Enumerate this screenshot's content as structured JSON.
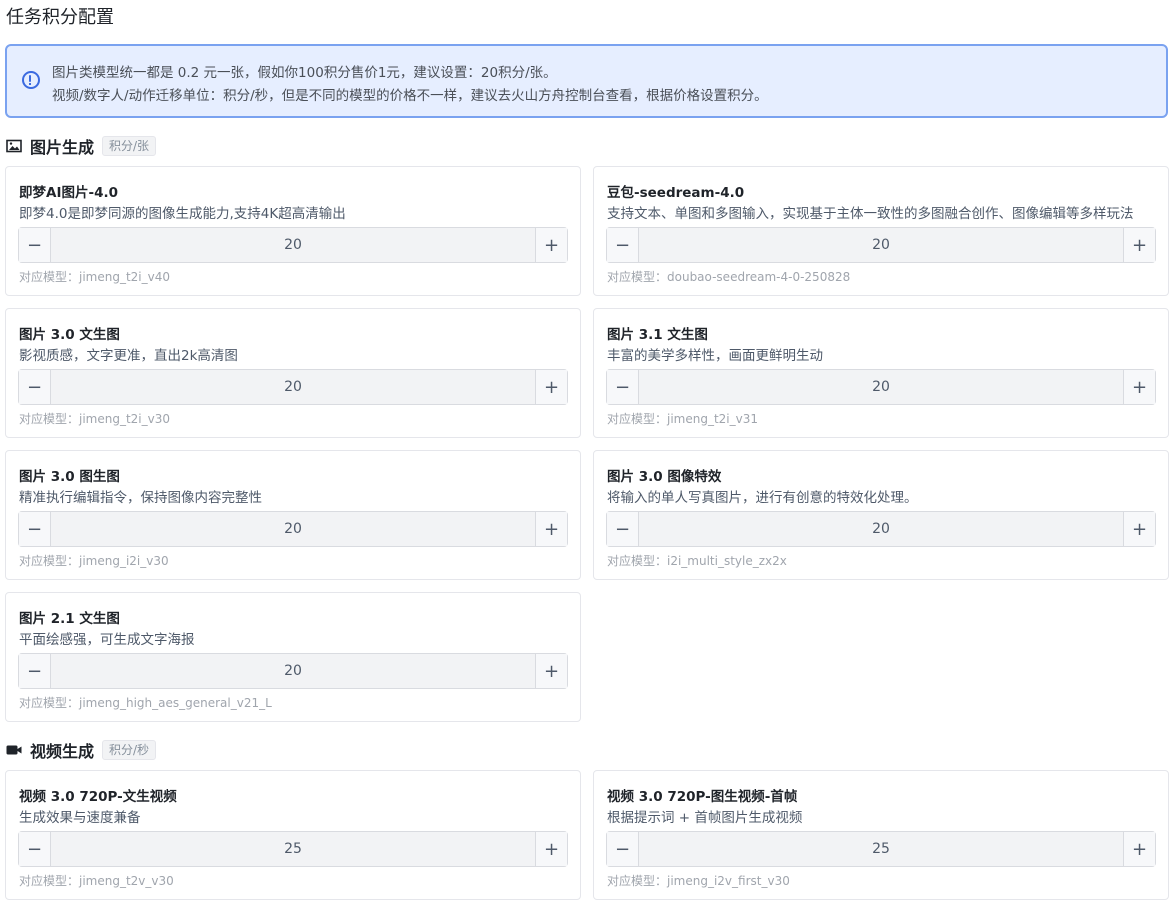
{
  "page_title": "任务积分配置",
  "alert": {
    "line1": "图片类模型统一都是 0.2 元一张，假如你100积分售价1元，建议设置：20积分/张。",
    "line2": "视频/数字人/动作迁移单位：积分/秒，但是不同的模型的价格不一样，建议去火山方舟控制台查看，根据价格设置积分。"
  },
  "sections": {
    "image": {
      "title": "图片生成",
      "unit_tag": "积分/张",
      "icon": "image-icon",
      "cards": [
        {
          "title": "即梦AI图片-4.0",
          "desc": "即梦4.0是即梦同源的图像生成能力,支持4K超高清输出",
          "value": "20",
          "model": "对应模型：jimeng_t2i_v40"
        },
        {
          "title": "豆包-seedream-4.0",
          "desc": "支持文本、单图和多图输入，实现基于主体一致性的多图融合创作、图像编辑等多样玩法",
          "value": "20",
          "model": "对应模型：doubao-seedream-4-0-250828"
        },
        {
          "title": "图片 3.0 文生图",
          "desc": "影视质感，文字更准，直出2k高清图",
          "value": "20",
          "model": "对应模型：jimeng_t2i_v30"
        },
        {
          "title": "图片 3.1 文生图",
          "desc": "丰富的美学多样性，画面更鲜明生动",
          "value": "20",
          "model": "对应模型：jimeng_t2i_v31"
        },
        {
          "title": "图片 3.0 图生图",
          "desc": "精准执行编辑指令，保持图像内容完整性",
          "value": "20",
          "model": "对应模型：jimeng_i2i_v30"
        },
        {
          "title": "图片 3.0 图像特效",
          "desc": "将输入的单人写真图片，进行有创意的特效化处理。",
          "value": "20",
          "model": "对应模型：i2i_multi_style_zx2x"
        },
        {
          "title": "图片 2.1 文生图",
          "desc": "平面绘感强，可生成文字海报",
          "value": "20",
          "model": "对应模型：jimeng_high_aes_general_v21_L"
        }
      ]
    },
    "video": {
      "title": "视频生成",
      "unit_tag": "积分/秒",
      "icon": "video-camera-icon",
      "cards": [
        {
          "title": "视频 3.0 720P-文生视频",
          "desc": "生成效果与速度兼备",
          "value": "25",
          "model": "对应模型：jimeng_t2v_v30"
        },
        {
          "title": "视频 3.0 720P-图生视频-首帧",
          "desc": "根据提示词 + 首帧图片生成视频",
          "value": "25",
          "model": "对应模型：jimeng_i2v_first_v30"
        }
      ]
    }
  },
  "stepper": {
    "minus": "−",
    "plus": "+"
  },
  "colors": {
    "accent": "#3b6ae0",
    "alert_bg": "#e6eeff",
    "alert_border": "#7aa2f0"
  }
}
